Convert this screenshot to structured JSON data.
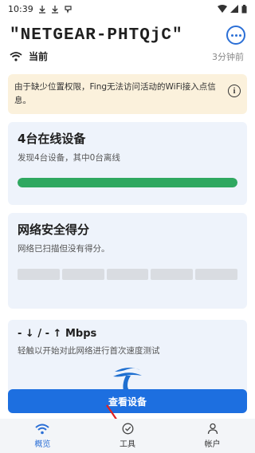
{
  "status_bar": {
    "time": "10:39"
  },
  "header": {
    "network_name": "\"NETGEAR-PHTQjC\""
  },
  "connection": {
    "label": "当前",
    "time": "3分钟前"
  },
  "warning": {
    "text": "由于缺少位置权限，Fing无法访问活动的WiFi接入点信息。"
  },
  "devices_card": {
    "title": "4台在线设备",
    "subtitle": "发现4台设备，其中0台离线",
    "online_fraction": 1.0
  },
  "security_card": {
    "title": "网络安全得分",
    "subtitle": "网络已扫描但没有得分。"
  },
  "speed_card": {
    "title": "- ↓ / - ↑ Mbps",
    "subtitle": "轻触以开始对此网络进行首次速度测试"
  },
  "primary_button": {
    "label": "查看设备"
  },
  "tabs": [
    {
      "label": "概览",
      "icon": "wifi-icon",
      "active": true
    },
    {
      "label": "工具",
      "icon": "check-circle-icon",
      "active": false
    },
    {
      "label": "帐户",
      "icon": "person-icon",
      "active": false
    }
  ],
  "colors": {
    "accent": "#1d6fe0",
    "progress": "#2fa860",
    "warning_bg": "#fbf1dc",
    "card_bg": "#eef3fb"
  }
}
